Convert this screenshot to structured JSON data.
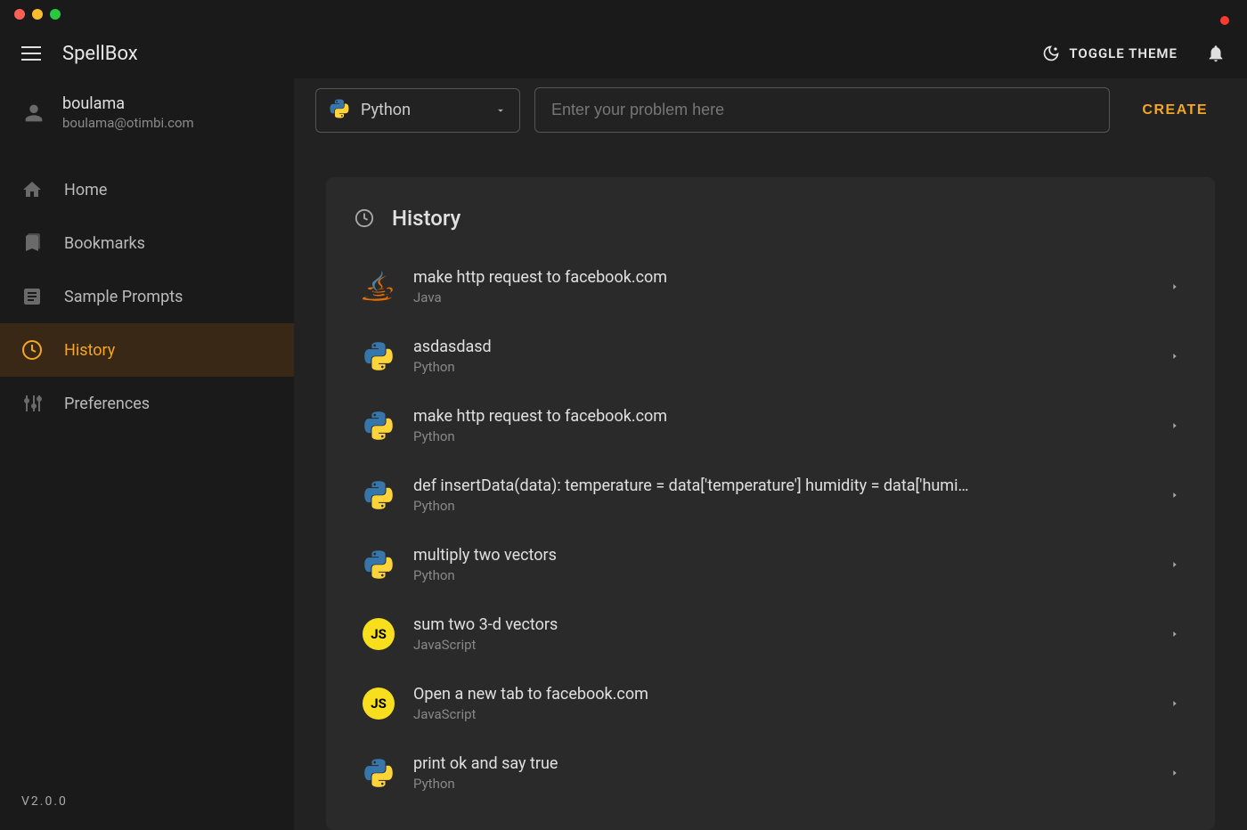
{
  "app": {
    "title": "SpellBox",
    "version": "V2.0.0"
  },
  "header": {
    "toggle_theme": "TOGGLE THEME"
  },
  "user": {
    "name": "boulama",
    "email": "boulama@otimbi.com"
  },
  "nav": {
    "items": [
      {
        "label": "Home",
        "icon": "home",
        "active": false
      },
      {
        "label": "Bookmarks",
        "icon": "bookmark",
        "active": false
      },
      {
        "label": "Sample Prompts",
        "icon": "doc",
        "active": false
      },
      {
        "label": "History",
        "icon": "clock",
        "active": true
      },
      {
        "label": "Preferences",
        "icon": "sliders",
        "active": false
      }
    ]
  },
  "input": {
    "language_selected": "Python",
    "placeholder": "Enter your problem here",
    "create_label": "CREATE"
  },
  "history": {
    "title": "History",
    "items": [
      {
        "prompt": "make http request to facebook.com",
        "language": "Java",
        "icon": "java"
      },
      {
        "prompt": "asdasdasd",
        "language": "Python",
        "icon": "python"
      },
      {
        "prompt": "make http request to facebook.com",
        "language": "Python",
        "icon": "python"
      },
      {
        "prompt": "def insertData(data): temperature = data['temperature'] humidity = data['humi…",
        "language": "Python",
        "icon": "python"
      },
      {
        "prompt": "multiply two vectors",
        "language": "Python",
        "icon": "python"
      },
      {
        "prompt": "sum two 3-d vectors",
        "language": "JavaScript",
        "icon": "js"
      },
      {
        "prompt": "Open a new tab to facebook.com",
        "language": "JavaScript",
        "icon": "js"
      },
      {
        "prompt": "print ok and say true",
        "language": "Python",
        "icon": "python"
      }
    ]
  }
}
